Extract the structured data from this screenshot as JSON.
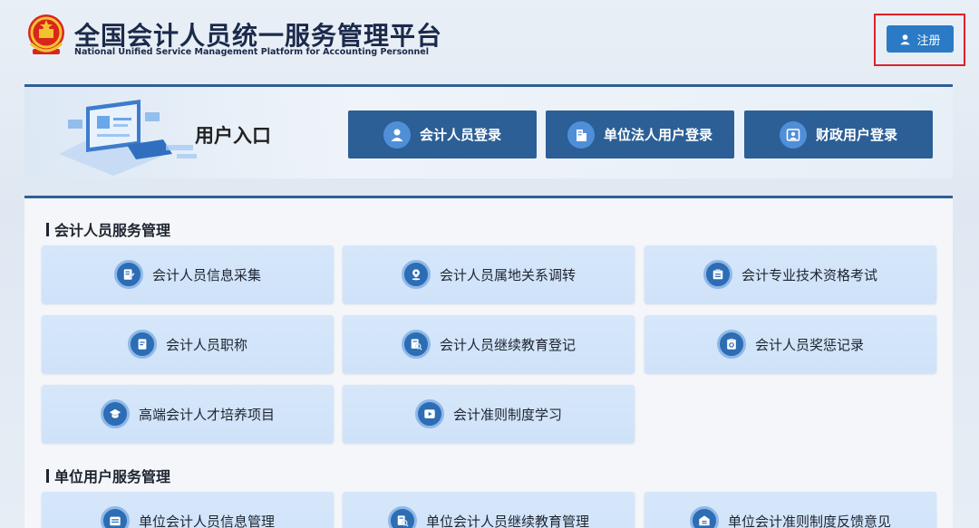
{
  "header": {
    "title_cn": "全国会计人员统一服务管理平台",
    "title_en": "National Unified Service Management Platform for Accounting Personnel",
    "register_label": "注册",
    "emblem_icon": "national-emblem-icon"
  },
  "entry": {
    "title": "用户入口",
    "buttons": [
      {
        "label": "会计人员登录",
        "icon": "user-icon"
      },
      {
        "label": "单位法人用户登录",
        "icon": "building-icon"
      },
      {
        "label": "财政用户登录",
        "icon": "portrait-icon"
      }
    ]
  },
  "sections": [
    {
      "title": "会计人员服务管理",
      "items": [
        {
          "label": "会计人员信息采集",
          "icon": "edit-document-icon"
        },
        {
          "label": "会计人员属地关系调转",
          "icon": "location-pin-icon"
        },
        {
          "label": "会计专业技术资格考试",
          "icon": "exam-icon"
        },
        {
          "label": "会计人员职称",
          "icon": "title-certificate-icon"
        },
        {
          "label": "会计人员继续教育登记",
          "icon": "education-search-icon"
        },
        {
          "label": "会计人员奖惩记录",
          "icon": "record-icon"
        },
        {
          "label": "高端会计人才培养项目",
          "icon": "graduation-cap-icon"
        },
        {
          "label": "会计准则制度学习",
          "icon": "play-icon"
        }
      ]
    },
    {
      "title": "单位用户服务管理",
      "items": [
        {
          "label": "单位会计人员信息管理",
          "icon": "info-manage-icon"
        },
        {
          "label": "单位会计人员继续教育管理",
          "icon": "education-search-icon"
        },
        {
          "label": "单位会计准则制度反馈意见",
          "icon": "feedback-icon"
        }
      ]
    }
  ],
  "colors": {
    "primary": "#2c5f96",
    "accent": "#2a7ac6",
    "highlight_border": "#e0202a",
    "card_bg": "#d6e7fb"
  }
}
